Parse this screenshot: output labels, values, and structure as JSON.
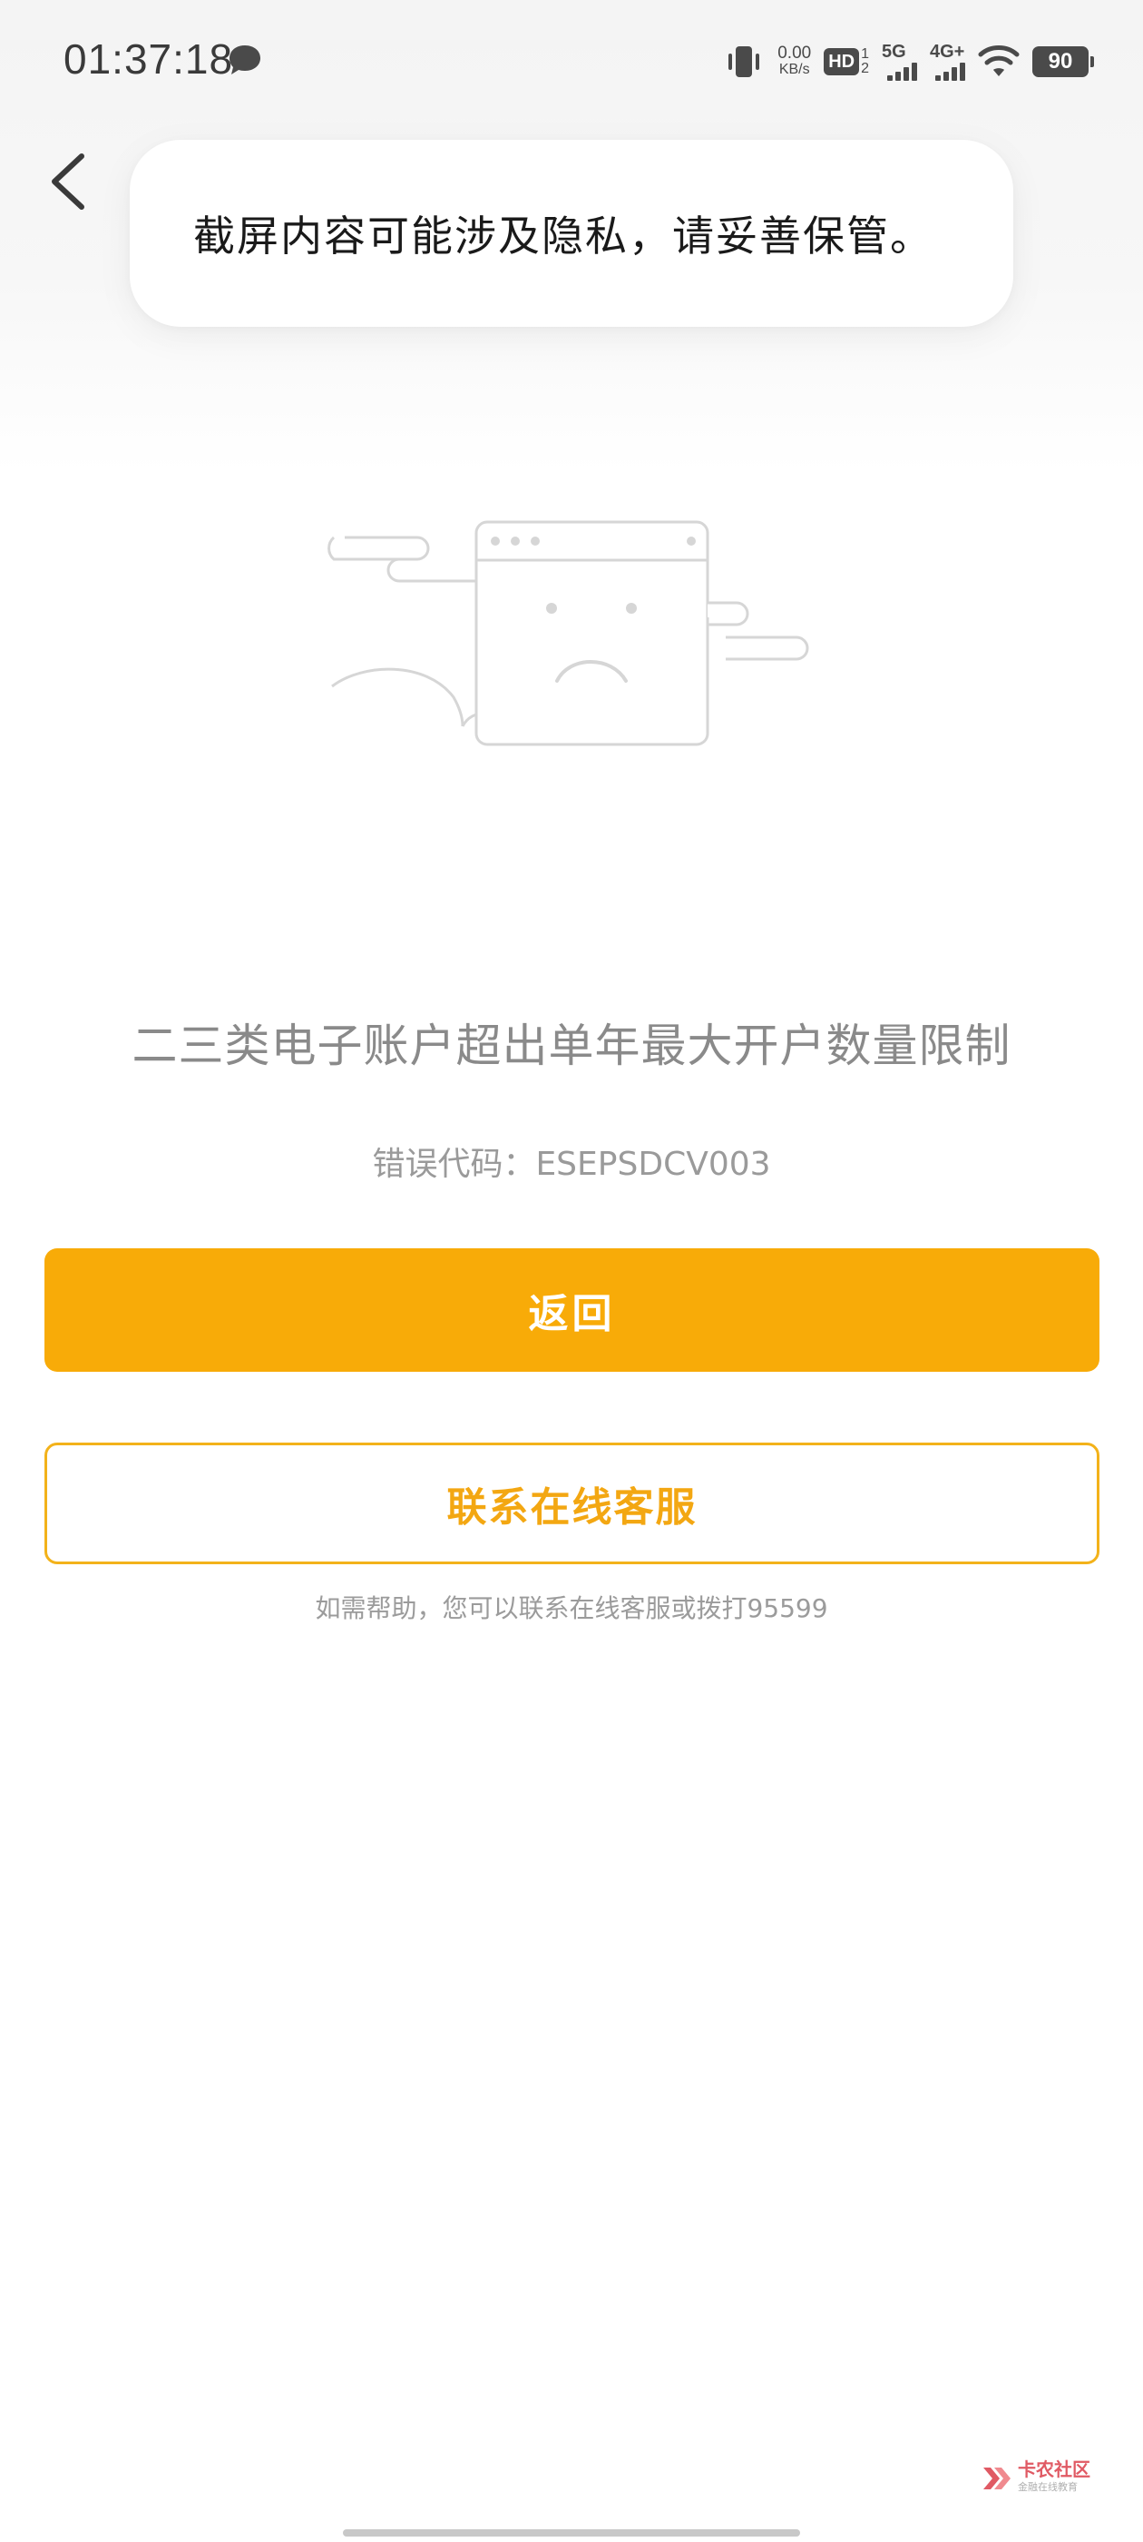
{
  "status_bar": {
    "time": "01:37:18",
    "net_speed_value": "0.00",
    "net_speed_unit": "KB/s",
    "hd_label": "HD",
    "hd_sim_top": "1",
    "hd_sim_bottom": "2",
    "network_1": "5G",
    "network_2": "4G+",
    "battery": "90",
    "icons": [
      "message-icon",
      "vibrate-icon",
      "wifi-icon"
    ]
  },
  "toast": {
    "text": "截屏内容可能涉及隐私，请妥善保管。"
  },
  "error": {
    "title": "二三类电子账户超出单年最大开户数量限制",
    "code": "错误代码：ESEPSDCV003"
  },
  "buttons": {
    "primary_label": "返回",
    "secondary_label": "联系在线客服"
  },
  "help_text": "如需帮助，您可以联系在线客服或拨打95599",
  "watermark": {
    "title": "卡农社区",
    "subtitle": "金融在线教育"
  },
  "colors": {
    "accent": "#f8ab08",
    "accent_border": "#f3b21a",
    "title_gray": "#8a8a8a"
  }
}
